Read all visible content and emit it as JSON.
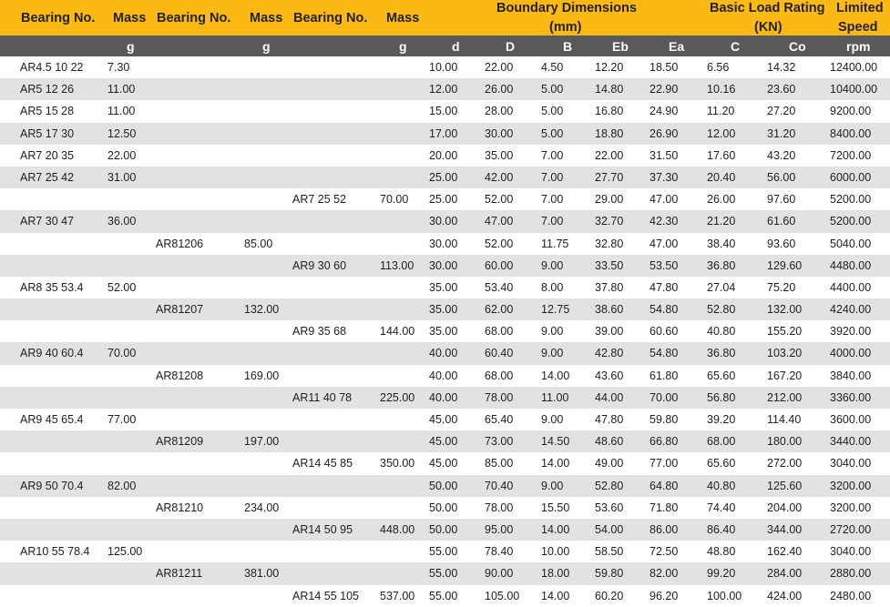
{
  "header": {
    "bearing_no": "Bearing No.",
    "mass": "Mass",
    "boundary_dimensions": "Boundary Dimensions",
    "mm": "(mm)",
    "basic_load_rating": "Basic Load Rating",
    "kn": "(KN)",
    "limited": "Limited",
    "speed": "Speed"
  },
  "units": {
    "g": "g",
    "d": "d",
    "D": "D",
    "B": "B",
    "Eb": "Eb",
    "Ea": "Ea",
    "C": "C",
    "Co": "Co",
    "rpm": "rpm"
  },
  "rows": [
    {
      "b1": "AR4.5 10 22",
      "m1": "7.30",
      "b2": "",
      "m2": "",
      "b3": "",
      "m3": "",
      "d": "10.00",
      "D": "22.00",
      "B": "4.50",
      "Eb": "12.20",
      "Ea": "18.50",
      "C": "6.56",
      "Co": "14.32",
      "rpm": "12400.00"
    },
    {
      "b1": "AR5 12 26",
      "m1": "11.00",
      "b2": "",
      "m2": "",
      "b3": "",
      "m3": "",
      "d": "12.00",
      "D": "26.00",
      "B": "5.00",
      "Eb": "14.80",
      "Ea": "22.90",
      "C": "10.16",
      "Co": "23.60",
      "rpm": "10400.00"
    },
    {
      "b1": "AR5 15 28",
      "m1": "11.00",
      "b2": "",
      "m2": "",
      "b3": "",
      "m3": "",
      "d": "15.00",
      "D": "28.00",
      "B": "5.00",
      "Eb": "16.80",
      "Ea": "24.90",
      "C": "11.20",
      "Co": "27.20",
      "rpm": "9200.00"
    },
    {
      "b1": "AR5 17 30",
      "m1": "12.50",
      "b2": "",
      "m2": "",
      "b3": "",
      "m3": "",
      "d": "17.00",
      "D": "30.00",
      "B": "5.00",
      "Eb": "18.80",
      "Ea": "26.90",
      "C": "12.00",
      "Co": "31.20",
      "rpm": "8400.00"
    },
    {
      "b1": "AR7 20 35",
      "m1": "22.00",
      "b2": "",
      "m2": "",
      "b3": "",
      "m3": "",
      "d": "20.00",
      "D": "35.00",
      "B": "7.00",
      "Eb": "22.00",
      "Ea": "31.50",
      "C": "17.60",
      "Co": "43.20",
      "rpm": "7200.00"
    },
    {
      "b1": "AR7 25 42",
      "m1": "31.00",
      "b2": "",
      "m2": "",
      "b3": "",
      "m3": "",
      "d": "25.00",
      "D": "42.00",
      "B": "7.00",
      "Eb": "27.70",
      "Ea": "37.30",
      "C": "20.40",
      "Co": "56.00",
      "rpm": "6000.00"
    },
    {
      "b1": "",
      "m1": "",
      "b2": "",
      "m2": "",
      "b3": "AR7 25 52",
      "m3": "70.00",
      "d": "25.00",
      "D": "52.00",
      "B": "7.00",
      "Eb": "29.00",
      "Ea": "47.00",
      "C": "26.00",
      "Co": "97.60",
      "rpm": "5200.00"
    },
    {
      "b1": "AR7 30 47",
      "m1": "36.00",
      "b2": "",
      "m2": "",
      "b3": "",
      "m3": "",
      "d": "30.00",
      "D": "47.00",
      "B": "7.00",
      "Eb": "32.70",
      "Ea": "42.30",
      "C": "21.20",
      "Co": "61.60",
      "rpm": "5200.00"
    },
    {
      "b1": "",
      "m1": "",
      "b2": "AR81206",
      "m2": "85.00",
      "b3": "",
      "m3": "",
      "d": "30.00",
      "D": "52.00",
      "B": "11.75",
      "Eb": "32.80",
      "Ea": "47.00",
      "C": "38.40",
      "Co": "93.60",
      "rpm": "5040.00"
    },
    {
      "b1": "",
      "m1": "",
      "b2": "",
      "m2": "",
      "b3": "AR9 30 60",
      "m3": "113.00",
      "d": "30.00",
      "D": "60.00",
      "B": "9.00",
      "Eb": "33.50",
      "Ea": "53.50",
      "C": "36.80",
      "Co": "129.60",
      "rpm": "4480.00"
    },
    {
      "b1": "AR8 35 53.4",
      "m1": "52.00",
      "b2": "",
      "m2": "",
      "b3": "",
      "m3": "",
      "d": "35.00",
      "D": "53.40",
      "B": "8.00",
      "Eb": "37.80",
      "Ea": "47.80",
      "C": "27.04",
      "Co": "75.20",
      "rpm": "4400.00"
    },
    {
      "b1": "",
      "m1": "",
      "b2": "AR81207",
      "m2": "132.00",
      "b3": "",
      "m3": "",
      "d": "35.00",
      "D": "62.00",
      "B": "12.75",
      "Eb": "38.60",
      "Ea": "54.80",
      "C": "52.80",
      "Co": "132.00",
      "rpm": "4240.00"
    },
    {
      "b1": "",
      "m1": "",
      "b2": "",
      "m2": "",
      "b3": "AR9 35 68",
      "m3": "144.00",
      "d": "35.00",
      "D": "68.00",
      "B": "9.00",
      "Eb": "39.00",
      "Ea": "60.60",
      "C": "40.80",
      "Co": "155.20",
      "rpm": "3920.00"
    },
    {
      "b1": "AR9 40 60.4",
      "m1": "70.00",
      "b2": "",
      "m2": "",
      "b3": "",
      "m3": "",
      "d": "40.00",
      "D": "60.40",
      "B": "9.00",
      "Eb": "42.80",
      "Ea": "54.80",
      "C": "36.80",
      "Co": "103.20",
      "rpm": "4000.00"
    },
    {
      "b1": "",
      "m1": "",
      "b2": "AR81208",
      "m2": "169.00",
      "b3": "",
      "m3": "",
      "d": "40.00",
      "D": "68.00",
      "B": "14.00",
      "Eb": "43.60",
      "Ea": "61.80",
      "C": "65.60",
      "Co": "167.20",
      "rpm": "3840.00"
    },
    {
      "b1": "",
      "m1": "",
      "b2": "",
      "m2": "",
      "b3": "AR11 40 78",
      "m3": "225.00",
      "d": "40.00",
      "D": "78.00",
      "B": "11.00",
      "Eb": "44.00",
      "Ea": "70.00",
      "C": "56.80",
      "Co": "212.00",
      "rpm": "3360.00"
    },
    {
      "b1": "AR9 45 65.4",
      "m1": "77.00",
      "b2": "",
      "m2": "",
      "b3": "",
      "m3": "",
      "d": "45.00",
      "D": "65.40",
      "B": "9.00",
      "Eb": "47.80",
      "Ea": "59.80",
      "C": "39.20",
      "Co": "114.40",
      "rpm": "3600.00"
    },
    {
      "b1": "",
      "m1": "",
      "b2": "AR81209",
      "m2": "197.00",
      "b3": "",
      "m3": "",
      "d": "45.00",
      "D": "73.00",
      "B": "14.50",
      "Eb": "48.60",
      "Ea": "66.80",
      "C": "68.00",
      "Co": "180.00",
      "rpm": "3440.00"
    },
    {
      "b1": "",
      "m1": "",
      "b2": "",
      "m2": "",
      "b3": "AR14 45 85",
      "m3": "350.00",
      "d": "45.00",
      "D": "85.00",
      "B": "14.00",
      "Eb": "49.00",
      "Ea": "77.00",
      "C": "65.60",
      "Co": "272.00",
      "rpm": "3040.00"
    },
    {
      "b1": "AR9 50 70.4",
      "m1": "82.00",
      "b2": "",
      "m2": "",
      "b3": "",
      "m3": "",
      "d": "50.00",
      "D": "70.40",
      "B": "9.00",
      "Eb": "52.80",
      "Ea": "64.80",
      "C": "40.80",
      "Co": "125.60",
      "rpm": "3200.00"
    },
    {
      "b1": "",
      "m1": "",
      "b2": "AR81210",
      "m2": "234.00",
      "b3": "",
      "m3": "",
      "d": "50.00",
      "D": "78.00",
      "B": "15.50",
      "Eb": "53.60",
      "Ea": "71.80",
      "C": "74.40",
      "Co": "204.00",
      "rpm": "3200.00"
    },
    {
      "b1": "",
      "m1": "",
      "b2": "",
      "m2": "",
      "b3": "AR14 50 95",
      "m3": "448.00",
      "d": "50.00",
      "D": "95.00",
      "B": "14.00",
      "Eb": "54.00",
      "Ea": "86.00",
      "C": "86.40",
      "Co": "344.00",
      "rpm": "2720.00"
    },
    {
      "b1": "AR10 55 78.4",
      "m1": "125.00",
      "b2": "",
      "m2": "",
      "b3": "",
      "m3": "",
      "d": "55.00",
      "D": "78.40",
      "B": "10.00",
      "Eb": "58.50",
      "Ea": "72.50",
      "C": "48.80",
      "Co": "162.40",
      "rpm": "3040.00"
    },
    {
      "b1": "",
      "m1": "",
      "b2": "AR81211",
      "m2": "381.00",
      "b3": "",
      "m3": "",
      "d": "55.00",
      "D": "90.00",
      "B": "18.00",
      "Eb": "59.80",
      "Ea": "82.00",
      "C": "99.20",
      "Co": "284.00",
      "rpm": "2880.00"
    },
    {
      "b1": "",
      "m1": "",
      "b2": "",
      "m2": "",
      "b3": "AR14 55 105",
      "m3": "537.00",
      "d": "55.00",
      "D": "105.00",
      "B": "14.00",
      "Eb": "60.20",
      "Ea": "96.20",
      "C": "100.00",
      "Co": "424.00",
      "rpm": "2480.00"
    }
  ]
}
